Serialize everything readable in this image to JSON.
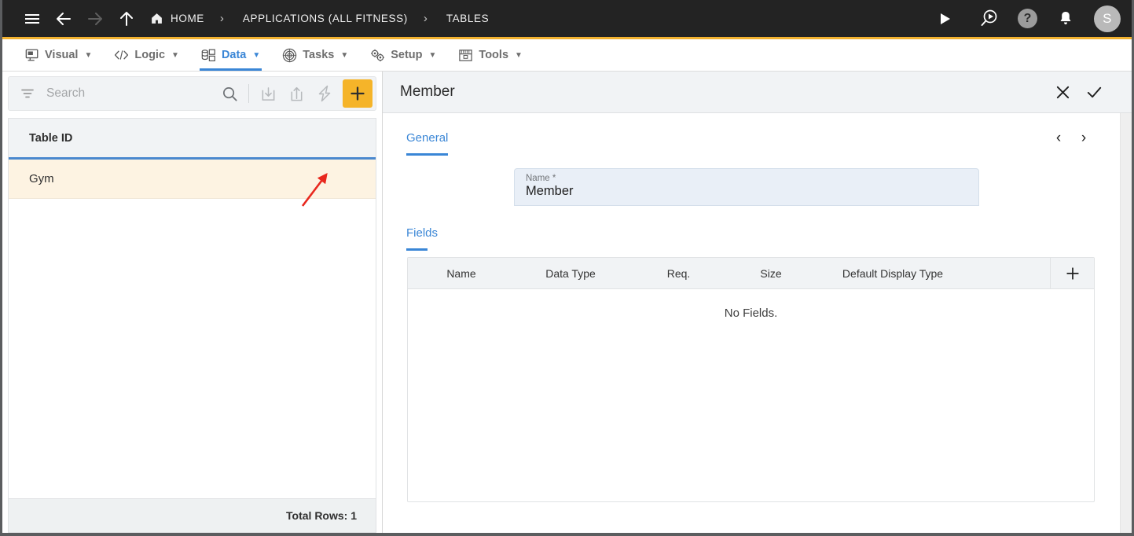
{
  "topbar": {
    "menu_icon": "hamburger-icon",
    "back_icon": "arrow-left-icon",
    "forward_icon": "arrow-right-icon",
    "up_icon": "arrow-up-icon",
    "breadcrumb": [
      {
        "label": "HOME",
        "icon": "home-icon"
      },
      {
        "label": "APPLICATIONS (ALL FITNESS)",
        "icon": ""
      },
      {
        "label": "TABLES",
        "icon": ""
      }
    ],
    "separator": "›",
    "actions": [
      {
        "name": "run-button",
        "icon": "play-icon"
      },
      {
        "name": "search-run-button",
        "icon": "magnifier-play-icon"
      },
      {
        "name": "help-button",
        "icon": "question-icon",
        "label": "?"
      },
      {
        "name": "notifications-button",
        "icon": "bell-icon"
      }
    ],
    "avatar_initial": "S",
    "background": "#232323",
    "accent": "#f2b230"
  },
  "menubar": {
    "items": [
      {
        "label": "Visual",
        "icon": "monitor-icon",
        "caret": "▼",
        "active": false
      },
      {
        "label": "Logic",
        "icon": "code-icon",
        "caret": "▼",
        "active": false
      },
      {
        "label": "Data",
        "icon": "database-icon",
        "caret": "▼",
        "active": true
      },
      {
        "label": "Tasks",
        "icon": "target-icon",
        "caret": "▼",
        "active": false
      },
      {
        "label": "Setup",
        "icon": "gears-icon",
        "caret": "▼",
        "active": false
      },
      {
        "label": "Tools",
        "icon": "toolbox-icon",
        "caret": "▼",
        "active": false
      }
    ],
    "active_color": "#3a86d6"
  },
  "sidebar": {
    "toolbar": {
      "filter_icon": "filter-icon",
      "search_placeholder": "Search",
      "search_value": "",
      "search_icon": "magnifier-icon",
      "import_icon": "import-download-icon",
      "export_icon": "export-share-icon",
      "lightning_icon": "lightning-bolt-icon",
      "add_label": "+",
      "add_color": "#f5b429"
    },
    "table": {
      "column_header": "Table ID",
      "rows": [
        {
          "table_id": "Gym",
          "selected": true
        }
      ],
      "row_highlight": "#fdf3e2",
      "header_underline": "#4a88cf"
    },
    "footer": {
      "total_rows_label": "Total Rows: 1"
    },
    "annotation": {
      "type": "arrow",
      "color": "#e8281e",
      "points_to": "lightning-bolt-icon"
    }
  },
  "main": {
    "header": {
      "title": "Member",
      "close_label": "✕",
      "confirm_label": "✓"
    },
    "tabs": [
      {
        "label": "General",
        "active": true
      }
    ],
    "record_nav": {
      "prev_label": "‹",
      "next_label": "›"
    },
    "name_field": {
      "label": "Name *",
      "value": "Member",
      "placeholder": "",
      "background": "#e9eff7"
    },
    "fields_section": {
      "section_label": "Fields",
      "add_label": "+",
      "columns": [
        "Name",
        "Data Type",
        "Req.",
        "Size",
        "Default Display Type"
      ],
      "rows": [],
      "empty_message": "No Fields."
    }
  }
}
